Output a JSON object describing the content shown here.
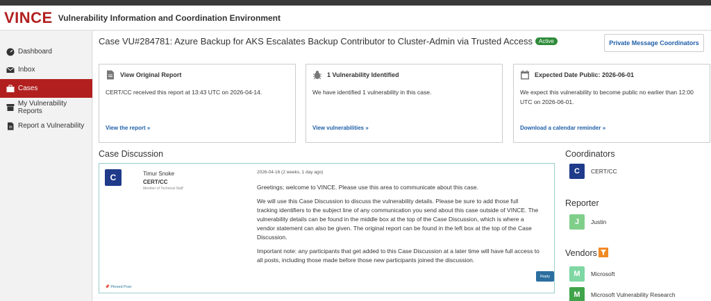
{
  "header": {
    "logo": "VINCE",
    "title": "Vulnerability Information and Coordination Environment"
  },
  "sidebar": {
    "items": [
      {
        "label": "Dashboard",
        "icon": "dashboard-icon"
      },
      {
        "label": "Inbox",
        "icon": "envelope-icon"
      },
      {
        "label": "Cases",
        "icon": "briefcase-icon",
        "active": true
      },
      {
        "label": "My Vulnerability Reports",
        "icon": "archive-icon"
      },
      {
        "label": "Report a Vulnerability",
        "icon": "document-icon"
      }
    ]
  },
  "case": {
    "title": "Case VU#284781: Azure Backup for AKS Escalates Backup Contributor to Cluster-Admin via Trusted Access",
    "status": "Active",
    "pm_button": "Private Message Coordinators"
  },
  "cards": [
    {
      "title": "View Original Report",
      "text": "CERT/CC received this report at 13:43 UTC on 2026-04-14.",
      "link": "View the report »",
      "icon": "file-icon"
    },
    {
      "title": "1 Vulnerability Identified",
      "text": "We have identified 1 vulnerability in this case.",
      "link": "View vulnerabilities »",
      "icon": "bug-icon"
    },
    {
      "title": "Expected Date Public: 2026-06-01",
      "text": "We expect this vulnerability to become public no earlier than 12:00 UTC on 2026-06-01.",
      "link": "Download a calendar reminder »",
      "icon": "calendar-icon"
    }
  ],
  "discussion": {
    "heading": "Case Discussion",
    "post": {
      "avatar": "C",
      "author": "Timur Snoke",
      "org": "CERT/CC",
      "role": "Member of Technical Staff",
      "date": "2026-04-16 (2 weeks, 1 day ago)",
      "paragraphs": [
        "Greetings; welcome to VINCE. Please use this area to communicate about this case.",
        "We will use this Case Discussion to discuss the vulnerability details. Please be sure to add those full tracking identifiers to the subject line of any communication you send about this case outside of VINCE. The vulnerability details can be found in the middle box at the top of the Case Discussion, which is where a vendor statement can also be given. The original report can be found in the left box at the top of the Case Discussion.",
        "Important note: any participants that get added to this Case Discussion at a later time will have full access to all posts, including those made before those new participants joined the discussion."
      ],
      "pinned": "Pinned Post",
      "reply": "Reply"
    }
  },
  "coordinators": {
    "heading": "Coordinators",
    "items": [
      {
        "initial": "C",
        "name": "CERT/CC",
        "color": "#1f3b8a"
      }
    ]
  },
  "reporter": {
    "heading": "Reporter",
    "items": [
      {
        "initial": "J",
        "name": "Justin",
        "color": "#7fcf8a"
      }
    ]
  },
  "vendors": {
    "heading": "Vendors",
    "filter_icon": "filter-icon",
    "items": [
      {
        "initial": "M",
        "name": "Microsoft",
        "color": "#7fd7a3"
      },
      {
        "initial": "M",
        "name": "Microsoft Vulnerability Research",
        "color": "#3fa44a"
      }
    ]
  }
}
